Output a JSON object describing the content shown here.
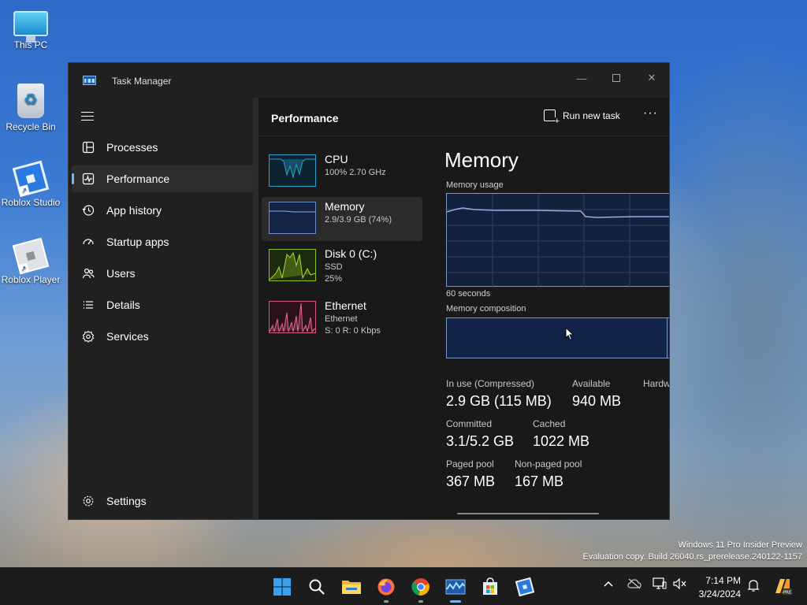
{
  "desktop": {
    "icons": [
      {
        "label": "This PC"
      },
      {
        "label": "Recycle Bin"
      },
      {
        "label": "Roblox Studio"
      },
      {
        "label": "Roblox Player"
      }
    ]
  },
  "window": {
    "title": "Task Manager",
    "controls": {
      "minimize": "—",
      "close": "✕"
    }
  },
  "sidebar": {
    "items": [
      {
        "label": "Processes",
        "icon": "processes-icon"
      },
      {
        "label": "Performance",
        "icon": "performance-icon",
        "active": true
      },
      {
        "label": "App history",
        "icon": "history-icon"
      },
      {
        "label": "Startup apps",
        "icon": "startup-icon"
      },
      {
        "label": "Users",
        "icon": "users-icon"
      },
      {
        "label": "Details",
        "icon": "details-icon"
      },
      {
        "label": "Services",
        "icon": "services-icon"
      }
    ],
    "settings_label": "Settings"
  },
  "header": {
    "title": "Performance",
    "run_task_label": "Run new task",
    "more_label": "···"
  },
  "devices": [
    {
      "name": "CPU",
      "sub1": "100%  2.70 GHz",
      "sub2": "",
      "color": "#2e9fd0"
    },
    {
      "name": "Memory",
      "sub1": "2.9/3.9 GB (74%)",
      "sub2": "",
      "color": "#6d8fc9",
      "active": true
    },
    {
      "name": "Disk 0 (C:)",
      "sub1": "SSD",
      "sub2": "25%",
      "color": "#8dbf1f"
    },
    {
      "name": "Ethernet",
      "sub1": "Ethernet",
      "sub2": "S: 0  R: 0 Kbps",
      "color": "#d65a7f"
    }
  ],
  "detail": {
    "title": "Memory",
    "usage_label": "Memory usage",
    "time_label": "60 seconds",
    "composition_label": "Memory composition",
    "stats": {
      "in_use_label": "In use (Compressed)",
      "in_use_value": "2.9 GB (115 MB)",
      "available_label": "Available",
      "available_value": "940 MB",
      "hardware_label": "Hardw",
      "committed_label": "Committed",
      "committed_value": "3.1/5.2 GB",
      "cached_label": "Cached",
      "cached_value": "1022 MB",
      "paged_label": "Paged pool",
      "paged_value": "367 MB",
      "nonpaged_label": "Non-paged pool",
      "nonpaged_value": "167 MB"
    }
  },
  "watermark": {
    "line1": "Windows 11 Pro Insider Preview",
    "line2": "Evaluation copy. Build 26040.rs_prerelease.240122-1157"
  },
  "taskbar": {
    "apps": [
      "start-icon",
      "search-icon",
      "file-explorer-icon",
      "firefox-icon",
      "chrome-icon",
      "task-manager-icon",
      "store-icon",
      "roblox-studio-icon"
    ],
    "clock_time": "7:14 PM",
    "clock_date": "3/24/2024"
  }
}
